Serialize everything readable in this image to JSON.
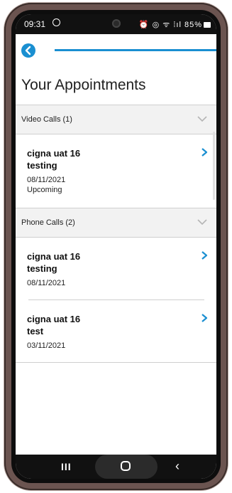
{
  "status_bar": {
    "time": "09:31",
    "icons_text": "⏰ ◎ ᯤ ⁞ıl",
    "battery": "85%"
  },
  "header": {
    "back_icon": "chevron-left-icon",
    "title": "Your Appointments"
  },
  "sections": [
    {
      "label": "Video Calls (1)",
      "items": [
        {
          "name_line1": "cigna uat 16",
          "name_line2": "testing",
          "date": "08/11/2021",
          "status": "Upcoming"
        }
      ]
    },
    {
      "label": "Phone Calls (2)",
      "items": [
        {
          "name_line1": "cigna uat 16",
          "name_line2": "testing",
          "date": "08/11/2021"
        },
        {
          "name_line1": "cigna uat 16",
          "name_line2": "test",
          "date": "03/11/2021"
        }
      ]
    }
  ],
  "nav": {
    "recents_label": "III",
    "back_label": "‹"
  },
  "colors": {
    "accent": "#1a8fd1",
    "section_bg": "#f2f2f2",
    "divider": "#cfcfcf"
  }
}
